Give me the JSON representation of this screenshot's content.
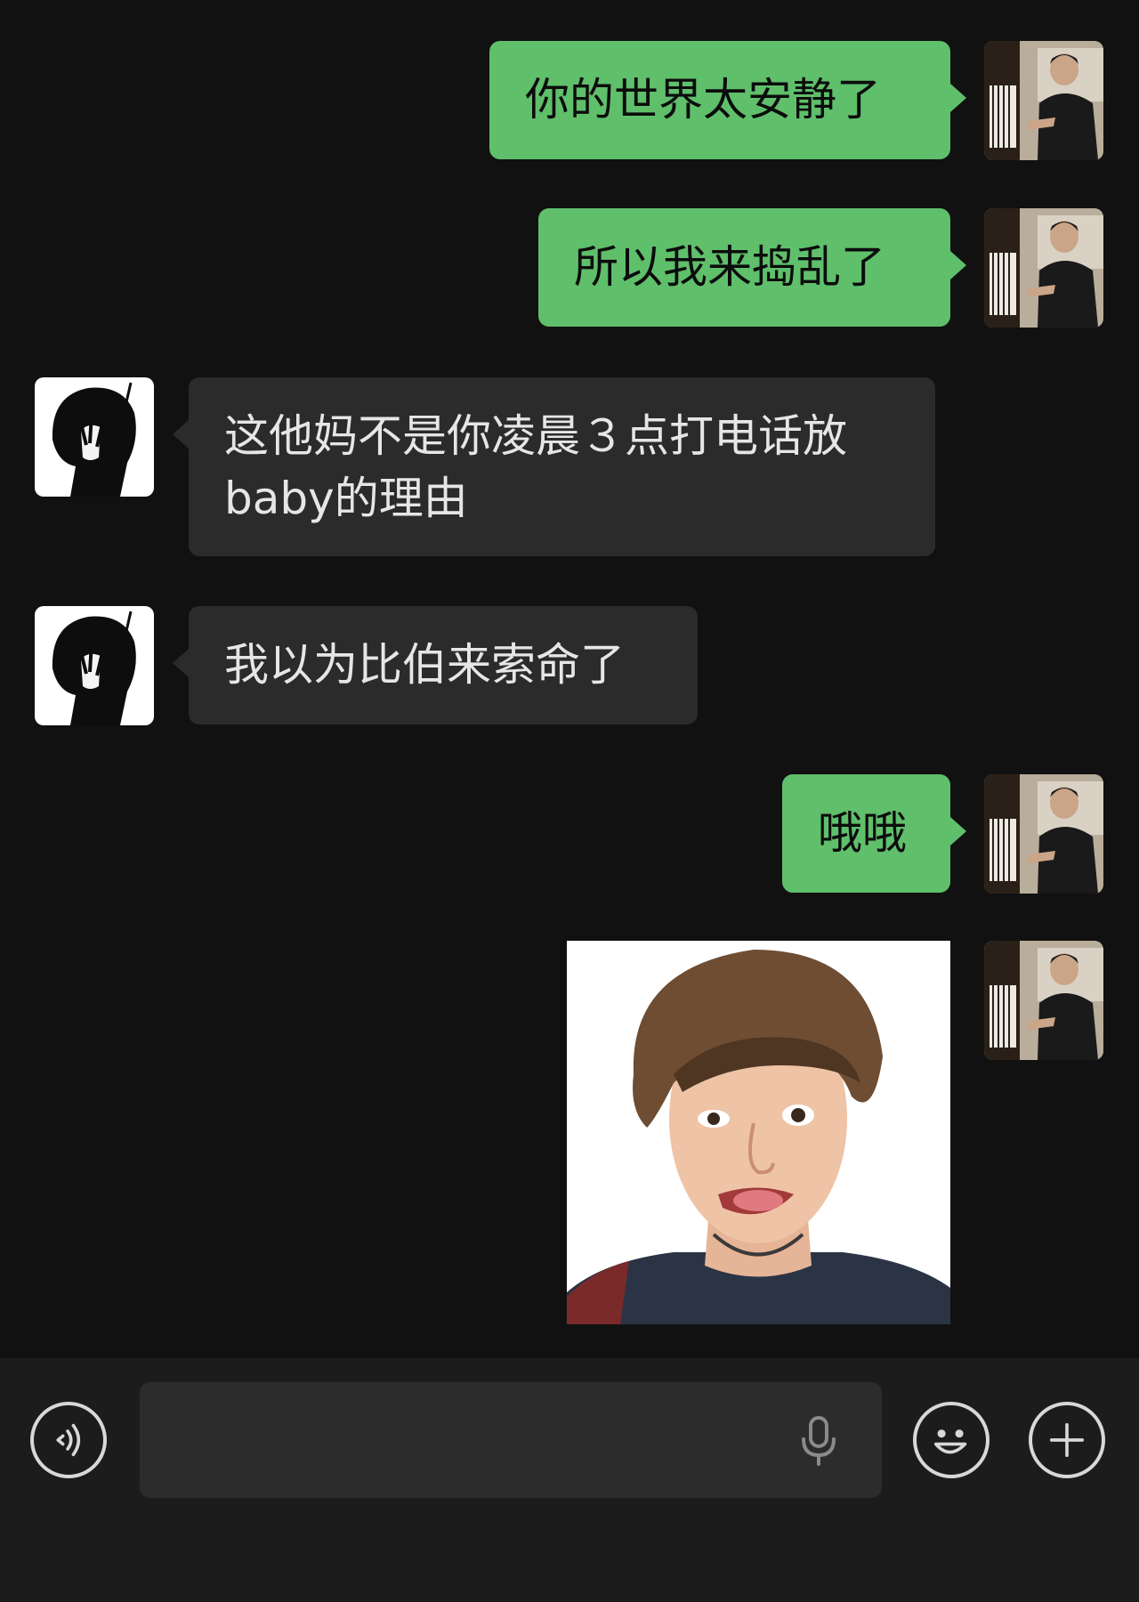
{
  "messages": [
    {
      "sender": "me",
      "type": "text",
      "text": "你的世界太安静了"
    },
    {
      "sender": "me",
      "type": "text",
      "text": "所以我来捣乱了"
    },
    {
      "sender": "other",
      "type": "text",
      "text": "这他妈不是你凌晨３点打电话放baby的理由"
    },
    {
      "sender": "other",
      "type": "text",
      "text": "我以为比伯来索命了"
    },
    {
      "sender": "me",
      "type": "text",
      "text": "哦哦"
    },
    {
      "sender": "me",
      "type": "image",
      "alt": "sticker"
    }
  ],
  "avatars": {
    "me": "piano-player-photo",
    "other": "anime-black-hair-silhouette"
  },
  "input_bar": {
    "voice_icon": "voice-toggle-icon",
    "field_value": "",
    "mic_icon": "microphone-icon",
    "emoji_icon": "emoji-smile-icon",
    "plus_icon": "plus-circle-icon"
  },
  "colors": {
    "background": "#111111",
    "outgoing_bubble": "#5fbf6b",
    "incoming_bubble": "#2b2b2b",
    "input_bar": "#1c1c1c"
  }
}
